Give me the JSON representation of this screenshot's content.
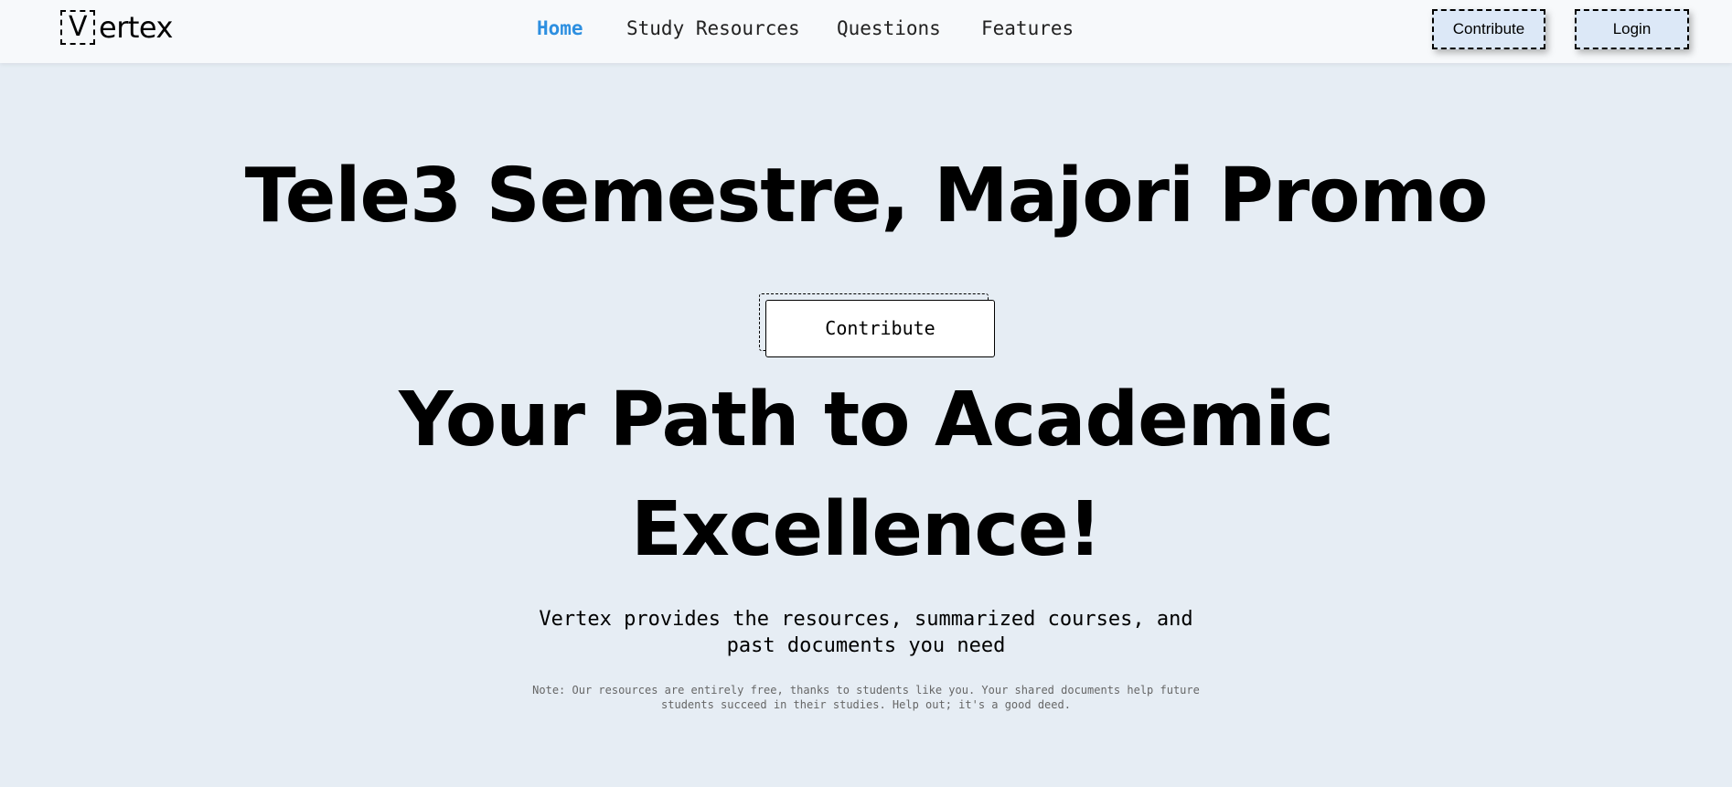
{
  "brand": {
    "logo_letter": "V",
    "logo_rest": "ertex"
  },
  "nav": {
    "items": [
      {
        "label": "Home",
        "active": true
      },
      {
        "label": "Study Resources",
        "active": false
      },
      {
        "label": "Questions",
        "active": false
      },
      {
        "label": "Features",
        "active": false
      }
    ]
  },
  "header_actions": {
    "contribute_label": "Contribute",
    "login_label": "Login"
  },
  "hero": {
    "title": "Tele3 Semestre, Majori Promo",
    "cta_label": "Contribute",
    "headline_line1": "Your Path to Academic",
    "headline_line2": "Excellence!",
    "subtitle_line1": "Vertex provides the resources, summarized courses, and",
    "subtitle_line2": "past documents you need",
    "note_line1": "Note: Our resources are entirely free, thanks to students like you. Your shared documents help future",
    "note_line2": "students succeed in their studies. Help out; it's a good deed."
  },
  "colors": {
    "page_background": "#e6edf4",
    "header_background": "#f7f9fb",
    "active_nav": "#2d8fe0",
    "header_button_fill": "#dce8f7"
  }
}
